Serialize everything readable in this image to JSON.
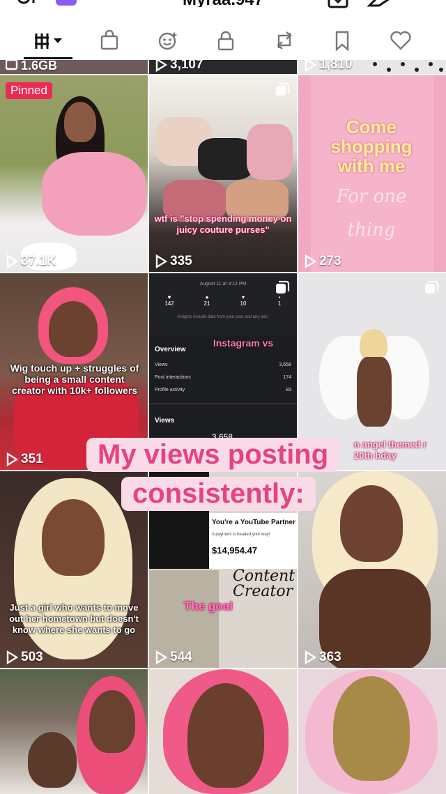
{
  "header": {
    "username": "Myraa.947"
  },
  "tabs": [
    {
      "name": "videos",
      "icon": "grid-icon"
    },
    {
      "name": "shop",
      "icon": "shopping-bag-icon"
    },
    {
      "name": "favorites-effects",
      "icon": "sticker-icon"
    },
    {
      "name": "private",
      "icon": "lock-icon"
    },
    {
      "name": "reposts",
      "icon": "repost-icon"
    },
    {
      "name": "saved",
      "icon": "bookmark-icon"
    },
    {
      "name": "liked",
      "icon": "heart-icon"
    }
  ],
  "top_partial_row": [
    "1.6GB",
    "3,107",
    "1,810"
  ],
  "posts": [
    {
      "views": "37.1K",
      "pinned": "Pinned",
      "caption": ""
    },
    {
      "views": "335",
      "caption": "wtf is \"stop spending money on juicy couture purses\""
    },
    {
      "views": "273",
      "caption_top": "Come shopping with me",
      "caption_script": "For one thing"
    },
    {
      "views": "351",
      "caption": "Wig touch up + struggles of being a small content creator with 10k+ followers"
    },
    {
      "views": "",
      "caption": "Instagram vs"
    },
    {
      "views": "",
      "caption": "n angel themed r 20th bday"
    },
    {
      "views": "503",
      "caption": "Just a girl who wants to move out her hometown but doesn't know where she wants to go"
    },
    {
      "views": "544",
      "caption": "The goal"
    },
    {
      "views": "363",
      "caption": ""
    }
  ],
  "insights": {
    "date": "August 11 at 3:12 PM",
    "stats": [
      "142",
      "21",
      "10",
      "1"
    ],
    "note": "Insights include data from your post and any ads.",
    "overview": "Overview",
    "rows": [
      {
        "label": "Views",
        "value": "3,658"
      },
      {
        "label": "Post interactions",
        "value": "174"
      },
      {
        "label": "Profile activity",
        "value": "83"
      }
    ],
    "views_label": "Views",
    "views_partial": "3,658"
  },
  "youtube": {
    "title": "You're a YouTube Partner",
    "sub": "A payment is headed your way!",
    "amount": "$14,954.47",
    "content_creator": "Content Creator"
  },
  "overlay": {
    "line1": "My views posting",
    "line2": "consistently:"
  },
  "colors": {
    "overlay_bg": "#f9dbe7",
    "overlay_text": "#e8427f",
    "pinned": "#ec2b55"
  }
}
